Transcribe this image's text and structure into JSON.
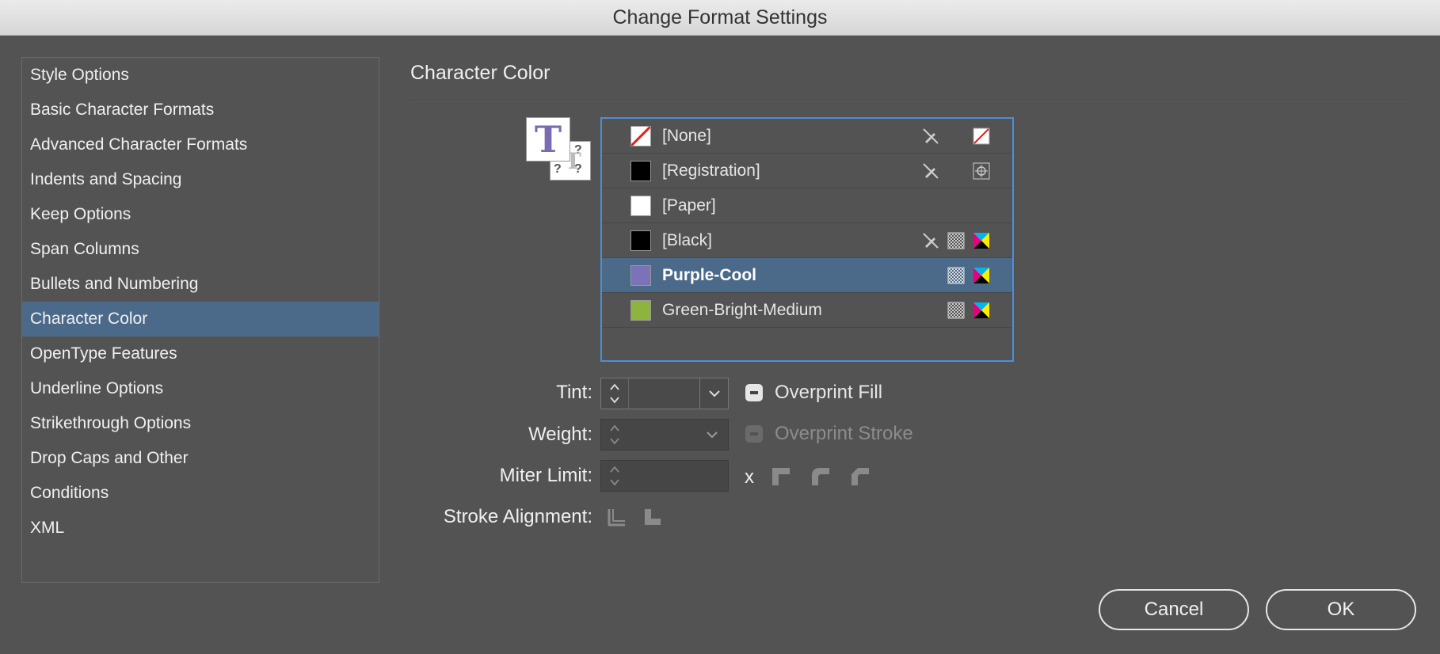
{
  "window": {
    "title": "Change Format Settings"
  },
  "sidebar": {
    "items": [
      {
        "label": "Style Options"
      },
      {
        "label": "Basic Character Formats"
      },
      {
        "label": "Advanced Character Formats"
      },
      {
        "label": "Indents and Spacing"
      },
      {
        "label": "Keep Options"
      },
      {
        "label": "Span Columns"
      },
      {
        "label": "Bullets and Numbering"
      },
      {
        "label": "Character Color",
        "selected": true
      },
      {
        "label": "OpenType Features"
      },
      {
        "label": "Underline Options"
      },
      {
        "label": "Strikethrough Options"
      },
      {
        "label": "Drop Caps and Other"
      },
      {
        "label": "Conditions"
      },
      {
        "label": "XML"
      }
    ]
  },
  "main": {
    "title": "Character Color",
    "swatches": [
      {
        "name": "[None]",
        "color": "none",
        "locked": true,
        "mode": "none"
      },
      {
        "name": "[Registration]",
        "color": "#000000",
        "locked": true,
        "mode": "registration"
      },
      {
        "name": "[Paper]",
        "color": "#ffffff"
      },
      {
        "name": "[Black]",
        "color": "#000000",
        "locked": true,
        "process": true,
        "mode": "cmyk"
      },
      {
        "name": "Purple-Cool",
        "color": "#7b72b8",
        "process": true,
        "mode": "cmyk",
        "selected": true
      },
      {
        "name": "Green-Bright-Medium",
        "color": "#8db43f",
        "process": true,
        "mode": "cmyk"
      }
    ],
    "tint": {
      "label": "Tint:",
      "value": ""
    },
    "weight": {
      "label": "Weight:",
      "value": ""
    },
    "miter_limit": {
      "label": "Miter Limit:",
      "value": "",
      "suffix": "x"
    },
    "stroke_alignment": {
      "label": "Stroke Alignment:"
    },
    "overprint_fill": {
      "label": "Overprint Fill",
      "state": "mixed",
      "enabled": true
    },
    "overprint_stroke": {
      "label": "Overprint Stroke",
      "state": "mixed",
      "enabled": false
    }
  },
  "buttons": {
    "cancel": "Cancel",
    "ok": "OK"
  },
  "colors": {
    "accent": "#4b6a8a",
    "focus": "#4a90d9",
    "background": "#535353"
  }
}
